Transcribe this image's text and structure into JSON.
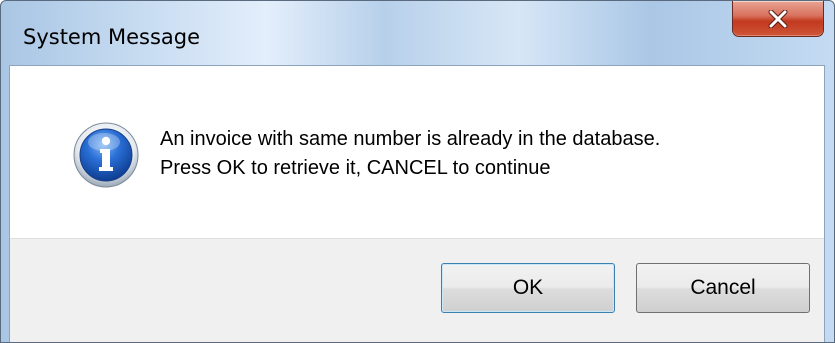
{
  "window": {
    "title": "System Message",
    "close_icon": "close-x-icon"
  },
  "message": {
    "icon": "info-icon",
    "line1": "An invoice with same number is already in the database.",
    "line2": "Press OK to retrieve it, CANCEL to continue"
  },
  "buttons": {
    "ok_label": "OK",
    "cancel_label": "Cancel"
  },
  "colors": {
    "titlebar_glass": "#c9ddf2",
    "close_button": "#c2391f",
    "info_icon_blue": "#1f63c7",
    "button_face": "#e5e5e5",
    "default_button_border": "#3c7fb1"
  }
}
